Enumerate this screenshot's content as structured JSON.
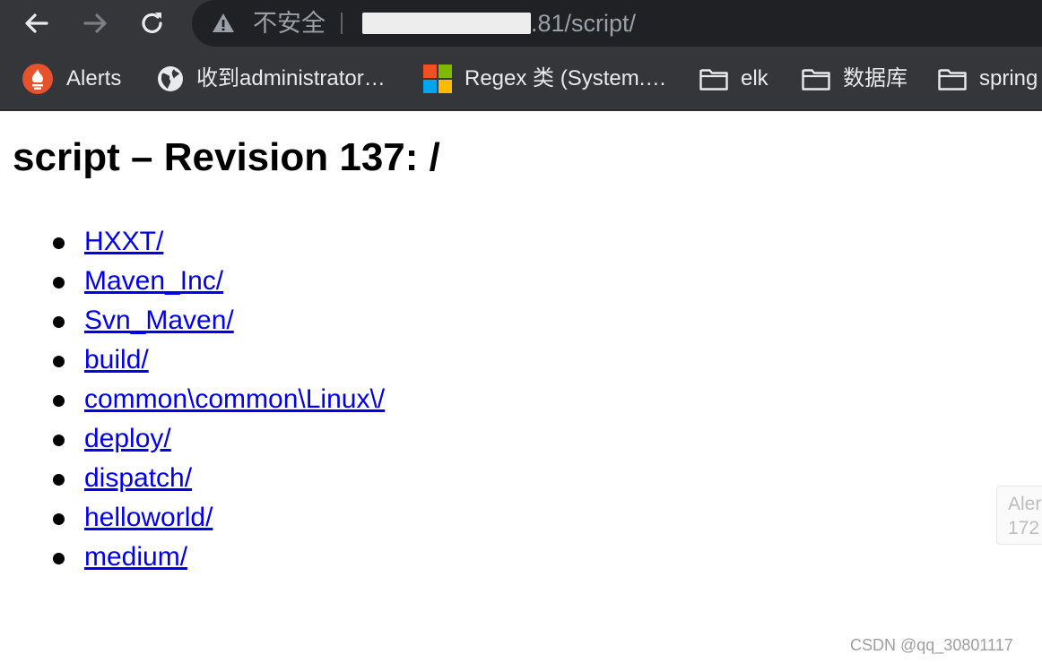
{
  "browser": {
    "security_label": "不安全",
    "url_visible": ".81/script/",
    "bookmarks": [
      {
        "label": "Alerts",
        "icon": "prometheus-icon"
      },
      {
        "label": "收到administrator…",
        "icon": "globe-icon"
      },
      {
        "label": "Regex 类 (System.…",
        "icon": "microsoft-icon"
      },
      {
        "label": "elk",
        "icon": "folder-icon"
      },
      {
        "label": "数据库",
        "icon": "folder-icon"
      },
      {
        "label": "spring",
        "icon": "folder-icon"
      }
    ]
  },
  "page": {
    "title": "script – Revision 137: /",
    "items": [
      "HXXT/",
      "Maven_Inc/",
      "Svn_Maven/",
      "build/",
      "common\\common\\Linux\\/",
      "deploy/",
      "dispatch/",
      "helloworld/",
      "medium/"
    ]
  },
  "tooltip": {
    "line1": "Aler",
    "line2": "172"
  },
  "watermark": "CSDN @qq_30801117",
  "colors": {
    "chrome": "#35363a",
    "omnibox": "#202124",
    "link": "#0000ee"
  }
}
